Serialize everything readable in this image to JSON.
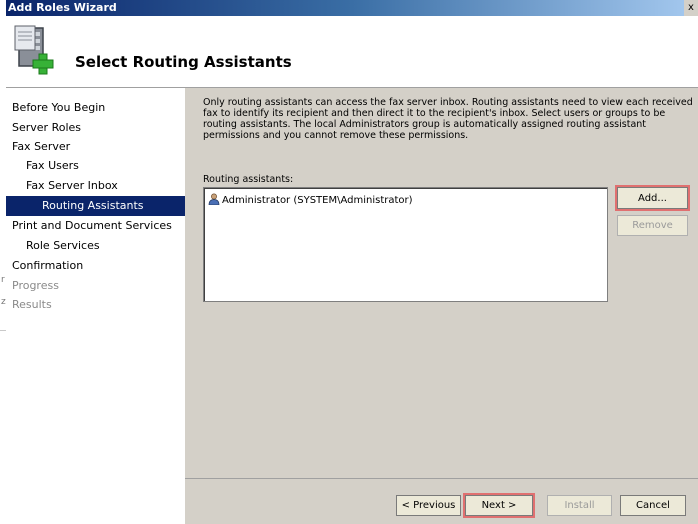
{
  "window": {
    "title": "Add Roles Wizard",
    "close_glyph": "x"
  },
  "header": {
    "title": "Select Routing Assistants",
    "icon": "server-roles-add-icon"
  },
  "nav": {
    "items": [
      {
        "label": "Before You Begin",
        "state": "normal"
      },
      {
        "label": "Server Roles",
        "state": "normal"
      },
      {
        "label": "Fax Server",
        "state": "normal"
      },
      {
        "label": "Fax Users",
        "state": "normal"
      },
      {
        "label": "Fax Server Inbox",
        "state": "normal"
      },
      {
        "label": "Routing Assistants",
        "state": "active"
      },
      {
        "label": "Print and Document Services",
        "state": "normal"
      },
      {
        "label": "Role Services",
        "state": "normal"
      },
      {
        "label": "Confirmation",
        "state": "normal"
      },
      {
        "label": "Progress",
        "state": "disabled"
      },
      {
        "label": "Results",
        "state": "disabled"
      }
    ]
  },
  "content": {
    "description": "Only routing assistants can access the fax server inbox. Routing assistants need to view each received fax to identify its recipient and then direct it to the recipient's inbox. Select users or groups to be routing assistants. The local Administrators group is automatically assigned routing assistant permissions and you cannot remove these permissions.",
    "list_label": "Routing assistants:",
    "assistants": [
      "Administrator (SYSTEM\\Administrator)"
    ],
    "add_label": "Add...",
    "remove_label": "Remove"
  },
  "footer": {
    "previous_label": "< Previous",
    "next_label": "Next >",
    "install_label": "Install",
    "cancel_label": "Cancel"
  },
  "colors": {
    "selection": "#0a246a",
    "highlight_box": "#e07070",
    "dialog_bg": "#d4d0c8"
  }
}
